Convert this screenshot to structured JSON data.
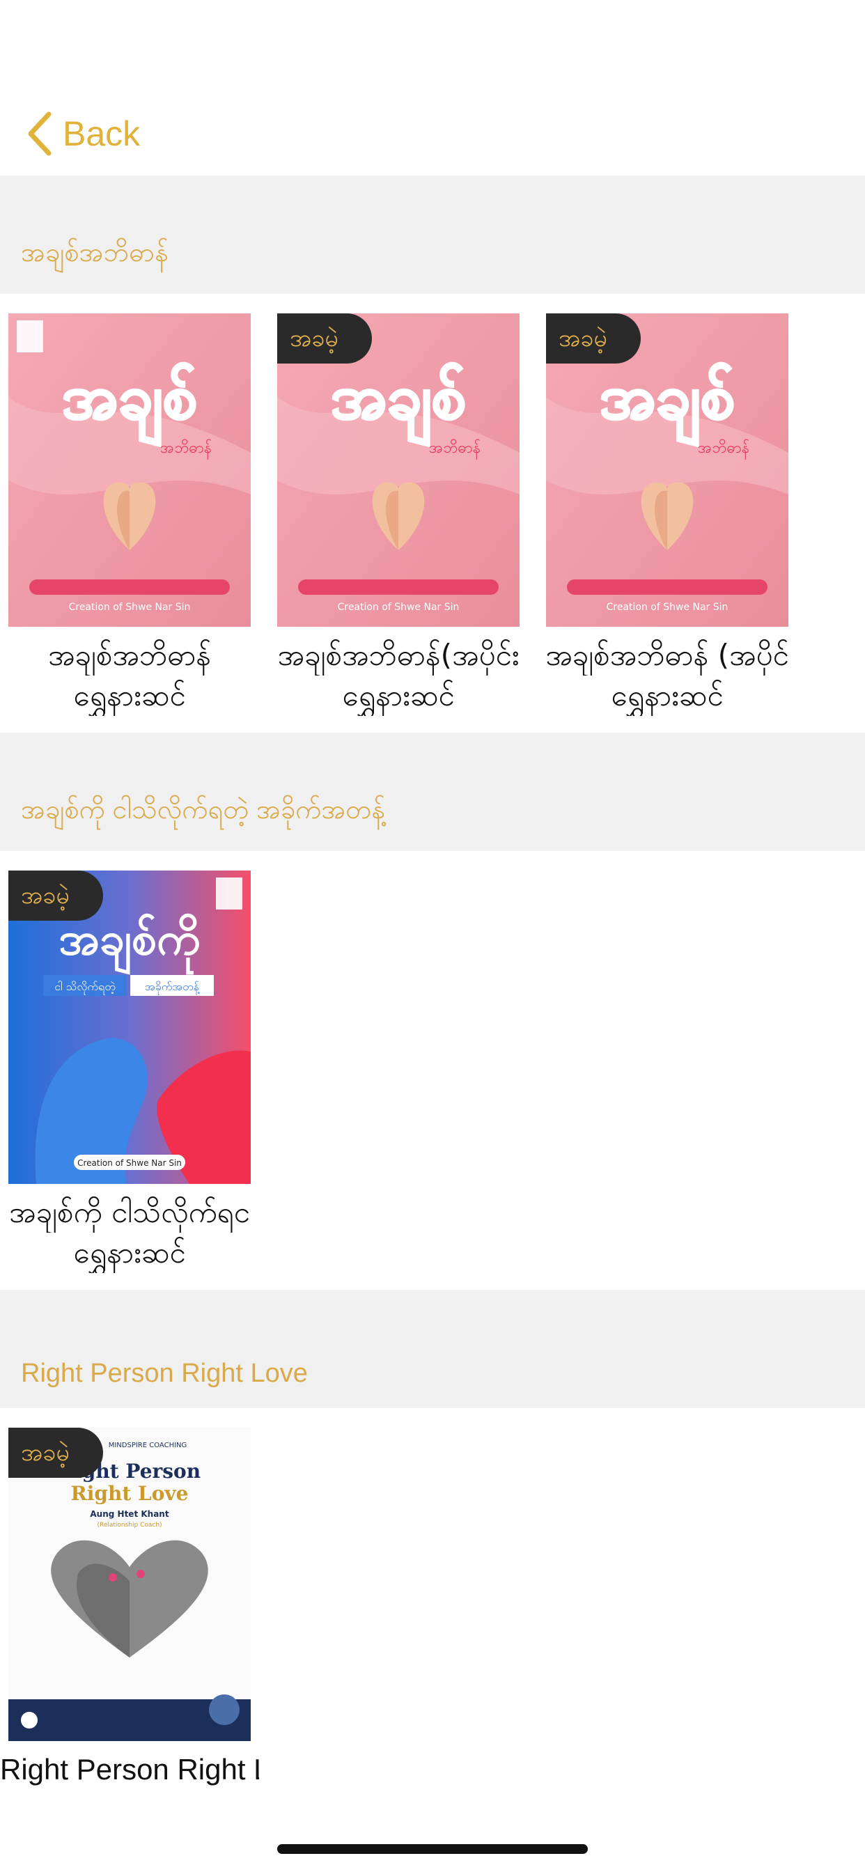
{
  "nav": {
    "back_label": "Back"
  },
  "sections": [
    {
      "title": "အချစ်အဘိဓာန်",
      "books": [
        {
          "title": "အချစ်အဘိဓာန်",
          "author": "ရွှေနားဆင်",
          "badge": "",
          "cover_title": "အချစ်",
          "cover_sub": "အဘိဓာန်",
          "cover_footer": "Creation of Shwe Nar Sin"
        },
        {
          "title": "အချစ်အဘိဓာန်(အပိုင်း",
          "author": "ရွှေနားဆင်",
          "badge": "အခမဲ့",
          "cover_title": "အချစ်",
          "cover_sub": "အဘိဓာန်",
          "cover_footer": "Creation of Shwe Nar Sin"
        },
        {
          "title": "အချစ်အဘိဓာန် (အပိုင်",
          "author": "ရွှေနားဆင်",
          "badge": "အခမဲ့",
          "cover_title": "အချစ်",
          "cover_sub": "အဘိဓာန်",
          "cover_footer": "Creation of Shwe Nar Sin"
        }
      ]
    },
    {
      "title": "အချစ်ကို ငါသိလိုက်ရတဲ့ အခိုက်အတန့်",
      "books": [
        {
          "title": "အချစ်ကို ငါသိလိုက်ရင",
          "author": "ရွှေနားဆင်",
          "badge": "အခမဲ့",
          "cover_title": "အချစ်ကို",
          "cover_sub1": "ငါ သိလိုက်ရတဲ့",
          "cover_sub2": "အခိုက်အတန့်",
          "cover_footer": "Creation of Shwe Nar Sin"
        }
      ]
    },
    {
      "title": "Right Person Right Love",
      "books": [
        {
          "title": "Right Person Right Lo",
          "author": "",
          "badge": "အခမဲ့",
          "cover_brand": "MINDSPIRE COACHING",
          "cover_title1": "Right Person",
          "cover_title2": "Right Love",
          "cover_author": "Aung Htet Khant",
          "cover_role": "(Relationship Coach)"
        }
      ]
    }
  ],
  "colors": {
    "accent": "#E0B23A",
    "section_title": "#D9A94A",
    "section_bg": "#F0F0F0",
    "badge_bg": "#2A2A2A"
  }
}
